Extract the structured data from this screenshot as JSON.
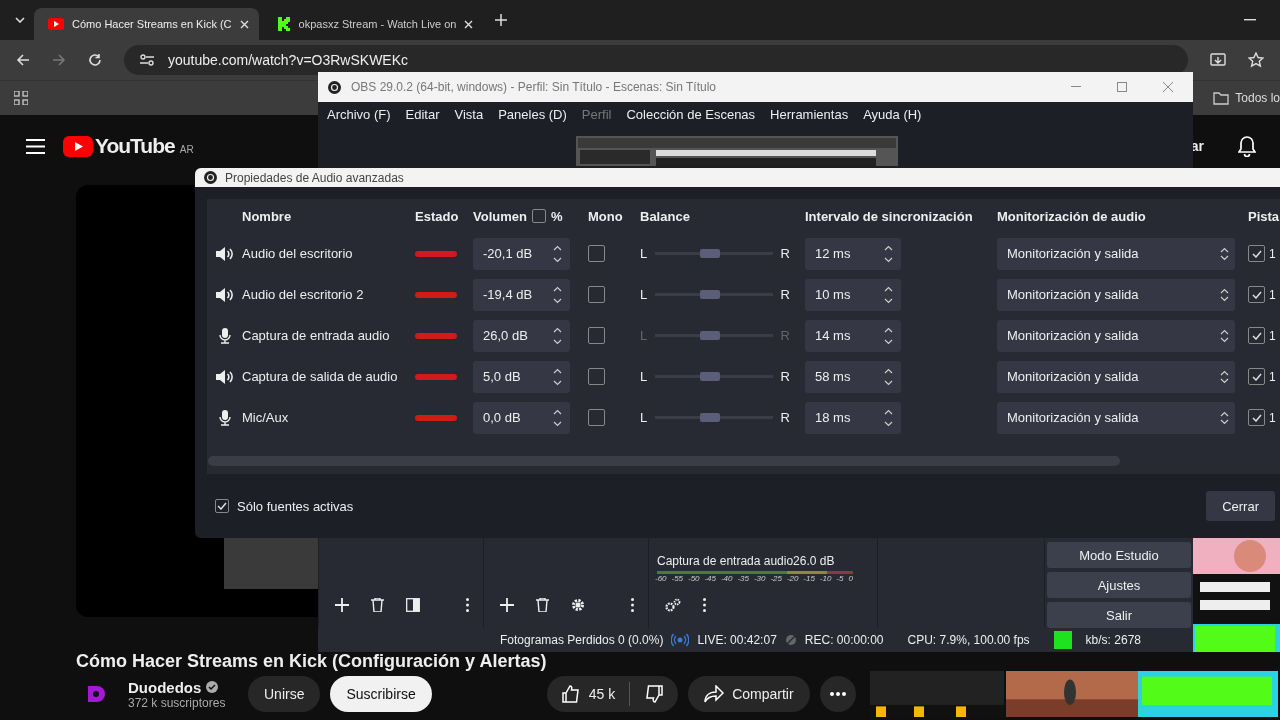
{
  "browser": {
    "tabs": [
      {
        "kind": "youtube",
        "title": "Cómo Hacer Streams en Kick (C",
        "selected": true
      },
      {
        "kind": "kick",
        "title": "okpasxz Stream - Watch Live on",
        "selected": false
      }
    ],
    "address": "youtube.com/watch?v=O3RwSKWEKc",
    "bookmark_folder": "Todos lo"
  },
  "youtube": {
    "logo": "YouTube",
    "region": "AR",
    "header_button": "ar",
    "video_title": "Cómo Hacer Streams en Kick (Configuración y Alertas)",
    "channel": "Duodedos",
    "verified": true,
    "subscribers": "372 k suscriptores",
    "join": "Unirse",
    "subscribe": "Suscribirse",
    "likes": "45 k",
    "share": "Compartir"
  },
  "obs": {
    "title": "OBS 29.0.2 (64-bit, windows) - Perfil: Sin Título - Escenas: Sin Título",
    "menu": [
      {
        "label": "Archivo (F)",
        "disabled": false
      },
      {
        "label": "Editar",
        "disabled": false
      },
      {
        "label": "Vista",
        "disabled": false
      },
      {
        "label": "Paneles (D)",
        "disabled": false
      },
      {
        "label": "Perfil",
        "disabled": true
      },
      {
        "label": "Colección de Escenas",
        "disabled": false
      },
      {
        "label": "Herramientas",
        "disabled": false
      },
      {
        "label": "Ayuda (H)",
        "disabled": false
      }
    ],
    "mixer": {
      "source": "Captura de entrada audio",
      "reading": "26.0 dB",
      "scale": [
        "-60",
        "-55",
        "-50",
        "-45",
        "-40",
        "-35",
        "-30",
        "-25",
        "-20",
        "-15",
        "-10",
        "-5",
        "0"
      ]
    },
    "controls": [
      "Modo Estudio",
      "Ajustes",
      "Salir"
    ],
    "status": {
      "dropped_frames": "Fotogramas Perdidos 0 (0.0%)",
      "live": "LIVE: 00:42:07",
      "rec": "REC: 00:00:00",
      "cpu": "CPU: 7.9%, 100.00 fps",
      "bitrate": "kb/s: 2678"
    }
  },
  "dialog": {
    "title": "Propiedades de Audio avanzadas",
    "columns": {
      "name": "Nombre",
      "status": "Estado",
      "volume": "Volumen",
      "percent": "%",
      "mono": "Mono",
      "balance": "Balance",
      "sync": "Intervalo de sincronización",
      "monitoring": "Monitorización de audio",
      "tracks": "Pista"
    },
    "percent_checked": false,
    "rows": [
      {
        "kind": "speaker",
        "name": "Audio del escritorio",
        "active": true,
        "volume": "-20,1 dB",
        "mono": false,
        "left": "L",
        "right": "R",
        "balance_enabled": true,
        "level": 0.47,
        "sync": "12 ms",
        "monitoring": "Monitorización y salida",
        "track_checked": true,
        "track": "1"
      },
      {
        "kind": "speaker",
        "name": "Audio del escritorio 2",
        "active": true,
        "volume": "-19,4 dB",
        "mono": false,
        "left": "L",
        "right": "R",
        "balance_enabled": true,
        "level": 0.47,
        "sync": "10 ms",
        "monitoring": "Monitorización y salida",
        "track_checked": true,
        "track": "1"
      },
      {
        "kind": "mic",
        "name": "Captura de entrada audio",
        "active": true,
        "volume": "26,0 dB",
        "mono": false,
        "left": "L",
        "right": "R",
        "balance_enabled": false,
        "level": 0.47,
        "sync": "14 ms",
        "monitoring": "Monitorización y salida",
        "track_checked": true,
        "track": "1"
      },
      {
        "kind": "speaker",
        "name": "Captura de salida de audio",
        "active": true,
        "volume": "5,0 dB",
        "mono": false,
        "left": "L",
        "right": "R",
        "balance_enabled": true,
        "level": 0.47,
        "sync": "58 ms",
        "monitoring": "Monitorización y salida",
        "track_checked": true,
        "track": "1"
      },
      {
        "kind": "mic",
        "name": "Mic/Aux",
        "active": true,
        "volume": "0,0 dB",
        "mono": false,
        "left": "L",
        "right": "R",
        "balance_enabled": true,
        "level": 0.47,
        "sync": "18 ms",
        "monitoring": "Monitorización y salida",
        "track_checked": true,
        "track": "1"
      }
    ],
    "active_only": {
      "label": "Sólo fuentes activas",
      "checked": true
    },
    "close": "Cerrar"
  }
}
